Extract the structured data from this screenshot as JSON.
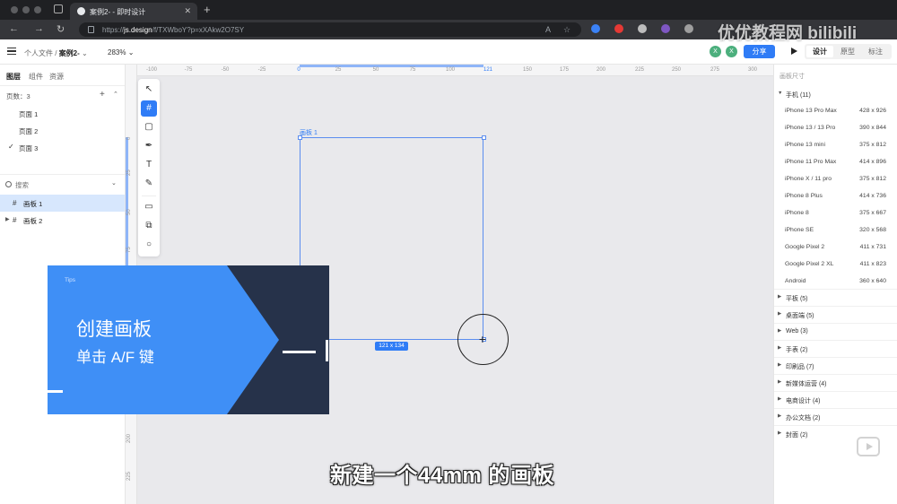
{
  "browser": {
    "tab_title": "案例2- - 即时设计",
    "url_scheme": "https://",
    "url_host": "js.design",
    "url_path": "/f/TXWboY?p=xXAkw2O7SY"
  },
  "header": {
    "breadcrumb_parent": "个人文件 /",
    "breadcrumb_current": "案例2-",
    "zoom": "283%",
    "avatar_1": "X",
    "avatar_2": "X",
    "share_label": "分享",
    "modes": [
      "设计",
      "原型",
      "标注"
    ]
  },
  "left_panel": {
    "tabs": [
      "图层",
      "组件",
      "资源"
    ],
    "pages_count_label": "页数：3",
    "pages": [
      "页面 1",
      "页面 2",
      "页面 3"
    ],
    "search_placeholder": "搜索",
    "layers": [
      "画板 1",
      "画板 2"
    ]
  },
  "canvas": {
    "ruler_top": [
      "-100",
      "-75",
      "-50",
      "-25",
      "0",
      "25",
      "50",
      "75",
      "100",
      "121",
      "150",
      "175",
      "200",
      "225",
      "250",
      "275",
      "300"
    ],
    "ruler_left": [
      "0",
      "25",
      "50",
      "75",
      "200",
      "225"
    ],
    "frame_label": "画板 1",
    "frame_size": "121 x 134"
  },
  "tips": {
    "label": "Tips",
    "title": "创建画板",
    "subtitle": "单击 A/F 键"
  },
  "right_panel": {
    "title": "画板尺寸",
    "phone_group": "手机 (11)",
    "devices": [
      {
        "name": "iPhone 13 Pro Max",
        "size": "428 x 926"
      },
      {
        "name": "iPhone 13 / 13 Pro",
        "size": "390 x 844"
      },
      {
        "name": "iPhone 13 mini",
        "size": "375 x 812"
      },
      {
        "name": "iPhone 11 Pro Max",
        "size": "414 x 896"
      },
      {
        "name": "iPhone X / 11 pro",
        "size": "375 x 812"
      },
      {
        "name": "iPhone 8 Plus",
        "size": "414 x 736"
      },
      {
        "name": "iPhone 8",
        "size": "375 x 667"
      },
      {
        "name": "iPhone SE",
        "size": "320 x 568"
      },
      {
        "name": "Google Pixel 2",
        "size": "411 x 731"
      },
      {
        "name": "Google Pixel 2 XL",
        "size": "411 x 823"
      },
      {
        "name": "Android",
        "size": "360 x 640"
      }
    ],
    "groups": [
      "平板 (5)",
      "桌面端 (5)",
      "Web (3)",
      "手表 (2)",
      "印刷品 (7)",
      "新媒体运营 (4)",
      "电商设计 (4)",
      "办公文档 (2)",
      "封面 (2)"
    ]
  },
  "subtitle": "新建一个44mm 的画板",
  "watermark": "优优教程网 bilibili",
  "colors": {
    "accent": "#2f7cf6",
    "tips_blue": "#3f8ff6",
    "tips_dark": "#26324a"
  }
}
